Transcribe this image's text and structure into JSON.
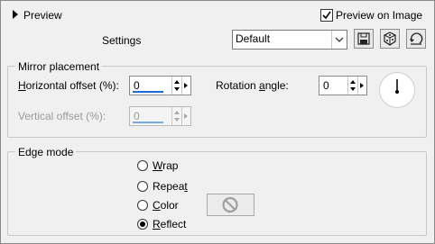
{
  "header": {
    "preview_label": "Preview",
    "preview_on_image_label": "Preview on Image",
    "preview_on_image_checked": true
  },
  "settings": {
    "label": "Settings",
    "selected": "Default"
  },
  "mirror_placement": {
    "title": "Mirror placement",
    "horizontal_offset_label_pre": "H",
    "horizontal_offset_label_post": "orizontal offset (%):",
    "horizontal_offset_value": "0",
    "vertical_offset_label": "Vertical offset (%):",
    "vertical_offset_value": "0",
    "rotation_angle_label_pre": "Rotation ",
    "rotation_angle_label_u": "a",
    "rotation_angle_label_post": "ngle:",
    "rotation_angle_value": "0"
  },
  "edge_mode": {
    "title": "Edge mode",
    "options": [
      {
        "pre": "",
        "u": "W",
        "post": "rap",
        "selected": false
      },
      {
        "pre": "Repea",
        "u": "t",
        "post": "",
        "selected": false
      },
      {
        "pre": "",
        "u": "C",
        "post": "olor",
        "selected": false
      },
      {
        "pre": "",
        "u": "R",
        "post": "eflect",
        "selected": true
      }
    ],
    "color_swatch_icon": "no-symbol-icon"
  }
}
